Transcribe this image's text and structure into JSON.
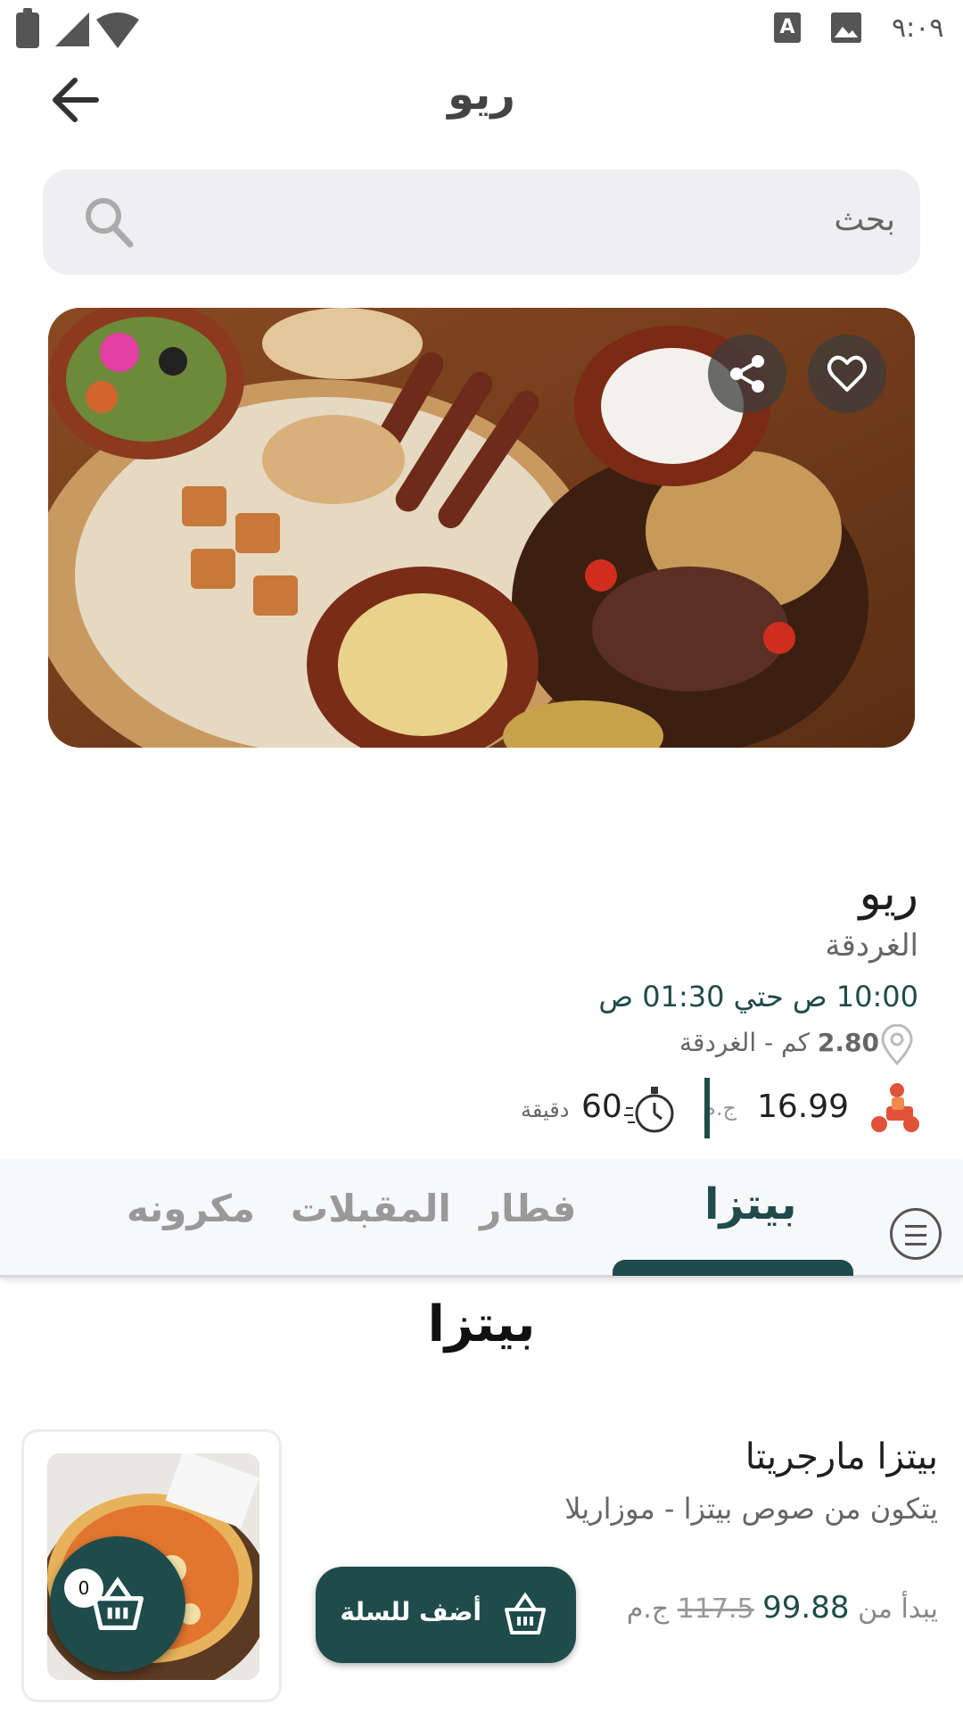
{
  "status_bar": {
    "time": "٩:٠٩",
    "a_icon_text": "A"
  },
  "header": {
    "title": "ريو"
  },
  "search": {
    "placeholder": "بحث"
  },
  "restaurant": {
    "name": "ريو",
    "city": "الغردقة",
    "hours": "10:00 ص حتي 01:30 ص",
    "distance_value": "2.80",
    "distance_text": "كم - الغردقة",
    "delivery_fee": "16.99",
    "delivery_currency": "ج.م",
    "delivery_time": "60",
    "delivery_time_unit": "دقيقة"
  },
  "tabs": [
    {
      "label": "بيتزا",
      "active": true
    },
    {
      "label": "فطار"
    },
    {
      "label": "المقبلات"
    },
    {
      "label": "مكرونه"
    }
  ],
  "section": {
    "title": "بيتزا"
  },
  "products": [
    {
      "name": "بيتزا مارجريتا",
      "description": "يتكون من صوص بيتزا - موزاريلا",
      "price_prefix": "يبدأ من",
      "price": "99.88",
      "old_price": "117.5",
      "currency": "ج.م",
      "add_label": "أضف للسلة"
    }
  ],
  "cart": {
    "count": "0"
  },
  "colors": {
    "primary": "#1f4c4a",
    "search_bg": "#efeff2",
    "tabbar_bg": "#f7f8fb"
  },
  "icons": [
    "battery-icon",
    "signal-icon",
    "wifi-icon",
    "back-arrow-icon",
    "search-icon",
    "share-icon",
    "heart-icon",
    "location-pin-icon",
    "scooter-icon",
    "timer-icon",
    "menu-icon",
    "cart-icon"
  ]
}
